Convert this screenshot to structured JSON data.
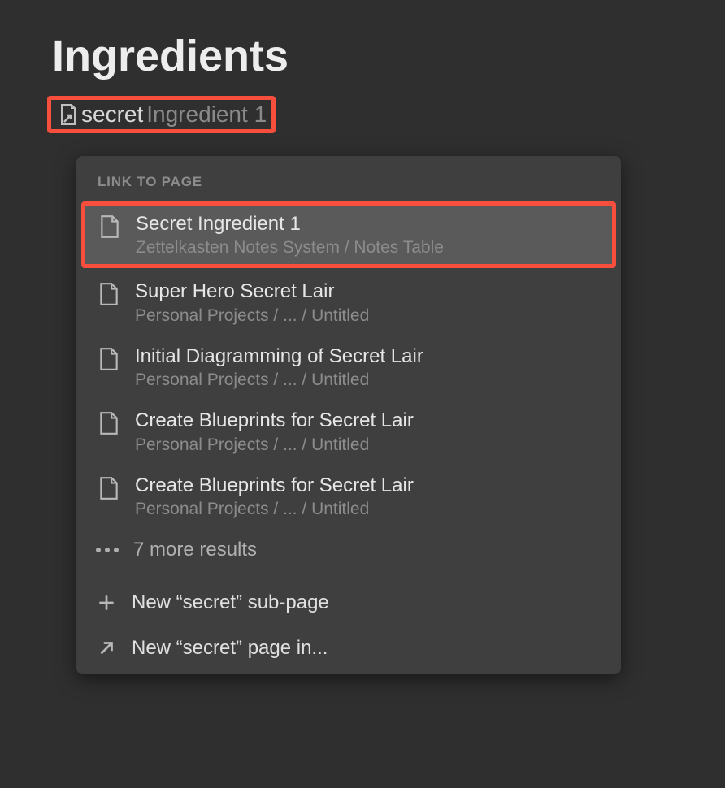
{
  "page": {
    "title": "Ingredients"
  },
  "link_input": {
    "typed": "secret",
    "ghost": "Ingredient 1"
  },
  "dropdown": {
    "section_label": "LINK TO PAGE",
    "results": [
      {
        "title": "Secret Ingredient 1",
        "path": "Zettelkasten Notes System / Notes Table",
        "selected": true,
        "highlighted": true
      },
      {
        "title": "Super Hero Secret Lair",
        "path": "Personal Projects / ... / Untitled",
        "selected": false,
        "highlighted": false
      },
      {
        "title": "Initial Diagramming of Secret Lair",
        "path": "Personal Projects / ... / Untitled",
        "selected": false,
        "highlighted": false
      },
      {
        "title": "Create Blueprints for Secret Lair",
        "path": "Personal Projects / ... / Untitled",
        "selected": false,
        "highlighted": false
      },
      {
        "title": "Create Blueprints for Secret Lair",
        "path": "Personal Projects / ... / Untitled",
        "selected": false,
        "highlighted": false
      }
    ],
    "more_results": "7 more results",
    "actions": {
      "new_subpage": "New “secret” sub-page",
      "new_page_in": "New “secret” page in..."
    }
  }
}
